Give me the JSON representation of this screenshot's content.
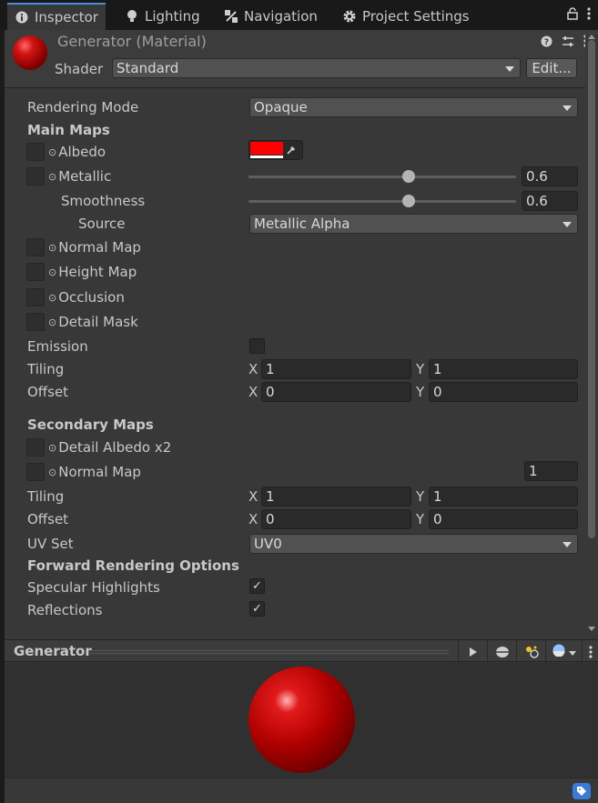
{
  "tabs": [
    {
      "label": "Inspector",
      "icon": "info-icon",
      "active": true
    },
    {
      "label": "Lighting",
      "icon": "bulb-icon",
      "active": false
    },
    {
      "label": "Navigation",
      "icon": "navigation-icon",
      "active": false
    },
    {
      "label": "Project Settings",
      "icon": "gear-icon",
      "active": false
    }
  ],
  "header": {
    "title": "Generator (Material)",
    "shader_label": "Shader",
    "shader_value": "Standard",
    "edit_label": "Edit..."
  },
  "props": {
    "rendering_mode_label": "Rendering Mode",
    "rendering_mode_value": "Opaque",
    "main_maps": "Main Maps",
    "albedo": "Albedo",
    "albedo_color": "#ff0000",
    "metallic": "Metallic",
    "metallic_value": "0.6",
    "smoothness": "Smoothness",
    "smoothness_value": "0.6",
    "source": "Source",
    "source_value": "Metallic Alpha",
    "normal_map": "Normal Map",
    "height_map": "Height Map",
    "occlusion": "Occlusion",
    "detail_mask": "Detail Mask",
    "emission": "Emission",
    "emission_checked": false,
    "tiling": "Tiling",
    "offset": "Offset",
    "x": "X",
    "y": "Y",
    "tiling_x": "1",
    "tiling_y": "1",
    "offset_x": "0",
    "offset_y": "0",
    "secondary_maps": "Secondary Maps",
    "detail_albedo": "Detail Albedo x2",
    "normal_map2": "Normal Map",
    "normal_map2_value": "1",
    "tiling2_x": "1",
    "tiling2_y": "1",
    "offset2_x": "0",
    "offset2_y": "0",
    "uv_set": "UV Set",
    "uv_set_value": "UV0",
    "forward_options": "Forward Rendering Options",
    "specular_highlights": "Specular Highlights",
    "specular_checked": true,
    "reflections": "Reflections",
    "reflections_checked": true
  },
  "preview": {
    "title": "Generator"
  },
  "checkmark": "✓",
  "accent_color": "#4d8cdb"
}
